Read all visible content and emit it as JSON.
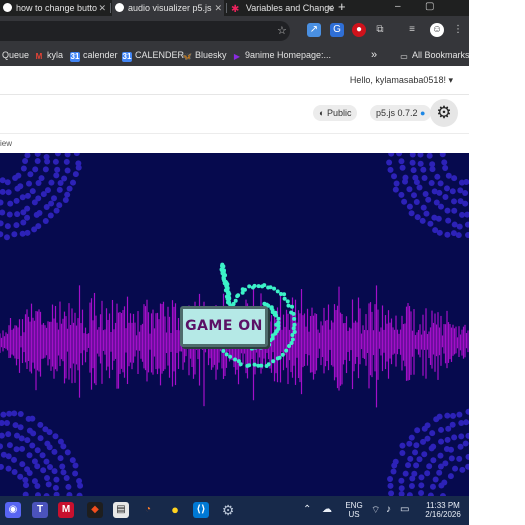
{
  "browser": {
    "tabs": [
      {
        "title": "how to change butto",
        "favicon": "google-icon",
        "active": false
      },
      {
        "title": "audio visualizer p5.js",
        "favicon": "google-icon",
        "active": true
      },
      {
        "title": "Variables and Change",
        "favicon": "p5-star-icon",
        "active": false
      }
    ],
    "new_tab": "+",
    "window_controls": [
      "–",
      "▢"
    ],
    "bookmarks": [
      {
        "label": "Queue",
        "icon": "none"
      },
      {
        "label": "kyla",
        "icon": "gmail-icon"
      },
      {
        "label": "calender",
        "icon": "calendar-icon"
      },
      {
        "label": "CALENDER",
        "icon": "calendar-icon"
      },
      {
        "label": "Bluesky",
        "icon": "bluesky-icon"
      },
      {
        "label": "9anime Homepage:...",
        "icon": "play-icon"
      }
    ],
    "bookmarks_overflow": "»",
    "all_bookmarks": "All Bookmarks"
  },
  "editor": {
    "greeting": "Hello, kylamasaba0518!",
    "visibility": "Public",
    "version": "p5.js 0.7.2",
    "preview_label": "iew"
  },
  "sketch": {
    "button_label": "GAME ON",
    "colors": {
      "background": "#060a4e",
      "wave": "#a30fc8",
      "dots": "#2d22b8",
      "spiral": "#3cf2c8",
      "button_fill": "#b5e9e6",
      "button_text": "#5b1166"
    }
  },
  "taskbar": {
    "apps": [
      "discord-icon",
      "teams-icon",
      "mcafee-icon",
      "figma-icon",
      "notepad-icon",
      "blender-icon",
      "duck-icon",
      "vscode-icon",
      "settings-icon"
    ],
    "lang": "ENG",
    "region": "US",
    "time": "11:33 PM",
    "date": "2/16/2026"
  }
}
